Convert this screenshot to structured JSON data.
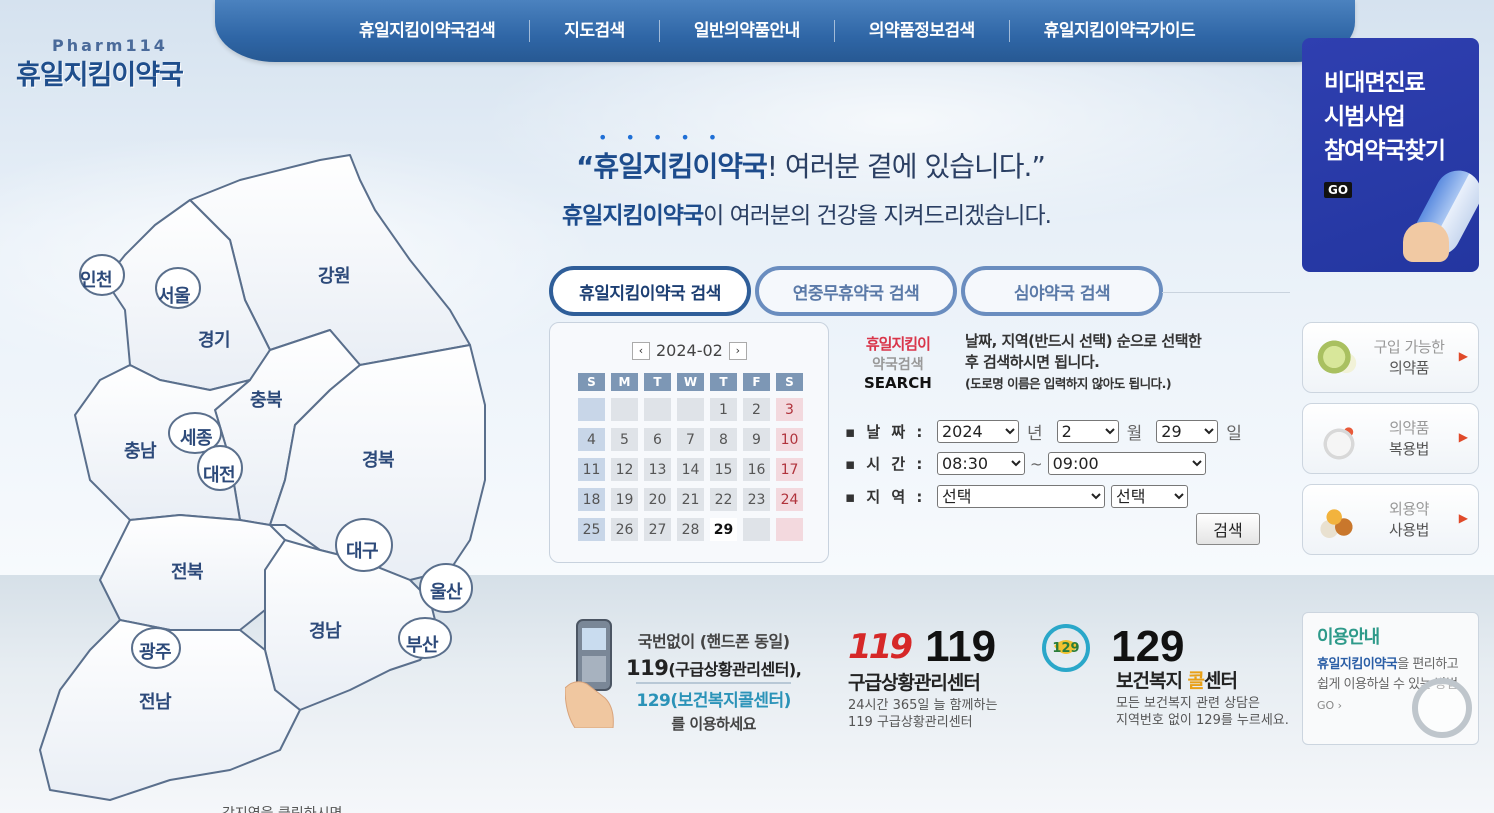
{
  "nav": {
    "items": [
      "휴일지킴이약국검색",
      "지도검색",
      "일반의약품안내",
      "의약품정보검색",
      "휴일지킴이약국가이드"
    ]
  },
  "logo": {
    "en": "Pharm114",
    "ko": "휴일지킴이약국"
  },
  "map": {
    "regions": [
      "인천",
      "서울",
      "경기",
      "강원",
      "충북",
      "충남",
      "세종",
      "대전",
      "경북",
      "대구",
      "전북",
      "울산",
      "경남",
      "부산",
      "광주",
      "전남"
    ],
    "hint": "각지역을 클릭하시면"
  },
  "slogan": {
    "line1_bold": "“휴일지킴이약국",
    "line1_rest": "! 여러분 곁에 있습니다.”",
    "line2_bold": "휴일지킴이약국",
    "line2_rest": "이 여러분의 건강을 지켜드리겠습니다."
  },
  "banner": {
    "line1": "비대면진료",
    "line2": "시범사업",
    "line3": "참여약국찾기",
    "go": "GO"
  },
  "tabs": [
    "휴일지킴이약국 검색",
    "연중무휴약국 검색",
    "심야약국 검색"
  ],
  "calendar": {
    "month": "2024-02",
    "prev": "‹",
    "next": "›",
    "dows": [
      "S",
      "M",
      "T",
      "W",
      "T",
      "F",
      "S"
    ],
    "weeks": [
      [
        "",
        "",
        "",
        "",
        "1",
        "2",
        "3"
      ],
      [
        "4",
        "5",
        "6",
        "7",
        "8",
        "9",
        "10"
      ],
      [
        "11",
        "12",
        "13",
        "14",
        "15",
        "16",
        "17"
      ],
      [
        "18",
        "19",
        "20",
        "21",
        "22",
        "23",
        "24"
      ],
      [
        "25",
        "26",
        "27",
        "28",
        "29",
        "",
        ""
      ]
    ],
    "today": "29"
  },
  "search": {
    "brand1": "휴일지킴이",
    "brand2": "약국검색",
    "brand3": "SEARCH",
    "desc1": "날짜, 지역(반드시 선택) 순으로 선택한",
    "desc2": "후 검색하시면 됩니다.",
    "desc3": "(도로명 이름은 입력하지 않아도 됩니다.)",
    "date_label": "날 짜 :",
    "time_label": "시 간 :",
    "region_label": "지 역 :",
    "year": "2024",
    "year_unit": "년",
    "month": "2",
    "month_unit": "월",
    "day": "29",
    "day_unit": "일",
    "time_from": "08:30",
    "time_sep": "~",
    "time_to": "09:00",
    "region1": "선택",
    "region2": "선택",
    "button": "검색"
  },
  "side_links": [
    {
      "line1": "구입 가능한",
      "line2": "의약품"
    },
    {
      "line1": "의약품",
      "line2": "복용법"
    },
    {
      "line1": "외용약",
      "line2": "사용법"
    }
  ],
  "phone_info": {
    "l1": "국번없이 (핸드폰 동일)",
    "l2a": "119",
    "l2b": "(구급상황관리센터),",
    "l3": "129(보건복지콜센터)",
    "l4": "를 이용하세요"
  },
  "e119": {
    "logo": "119",
    "num": "119",
    "title": "구급상황관리센터",
    "desc1": "24시간 365일 늘 함께하는",
    "desc2": "119 구급상황관리센터"
  },
  "e129": {
    "num": "129",
    "title_a": "보건복지 ",
    "title_b": "콜",
    "title_c": "센터",
    "desc1": "모든 보건복지 관련 상담은",
    "desc2": "지역번호 없이 129를 누르세요."
  },
  "usage": {
    "title": "이용안내",
    "bold": "휴일지킴이약국",
    "rest": "을 편리하고 쉽게 이용하실 수 있는 방법",
    "go": "GO ›"
  },
  "colors": {
    "nav": "#2f66a6",
    "banner": "#2336a0",
    "accent_red": "#d9354a",
    "map_stroke": "#5a6f8c"
  }
}
